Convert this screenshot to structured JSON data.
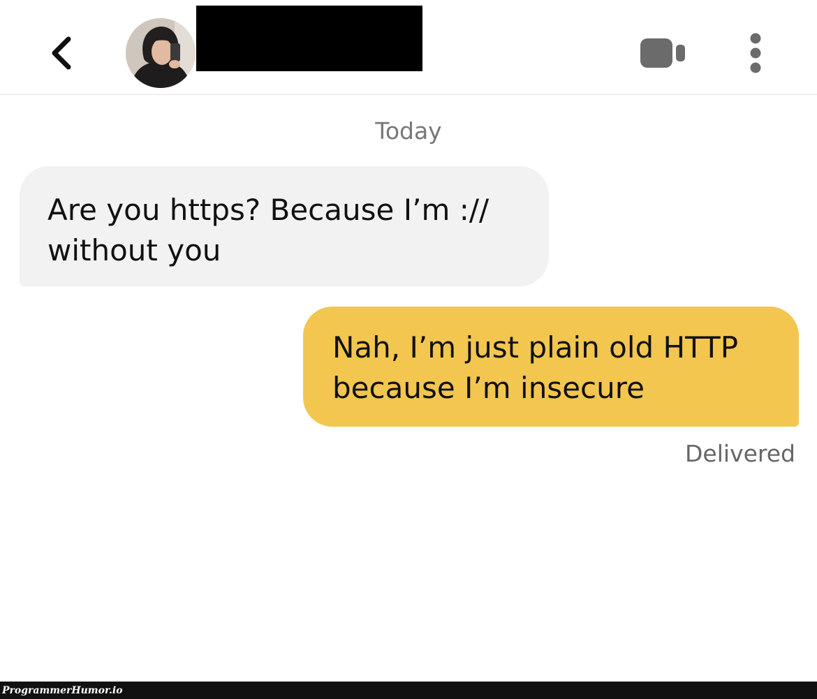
{
  "header": {
    "back_icon": "chevron-left-icon",
    "contact_name": "",
    "video_icon": "video-camera-icon",
    "more_icon": "more-vertical-icon",
    "icon_color": "#6b6b6b"
  },
  "conversation": {
    "date_divider": "Today",
    "messages": [
      {
        "direction": "received",
        "text": "Are you https? Because I’m :// without you",
        "bubble_color": "#f2f2f2"
      },
      {
        "direction": "sent",
        "text": "Nah, I’m just plain old HTTP because I’m insecure",
        "bubble_color": "#f2c64f"
      }
    ],
    "status": "Delivered"
  },
  "footer": {
    "watermark": "ProgrammerHumor.io"
  }
}
